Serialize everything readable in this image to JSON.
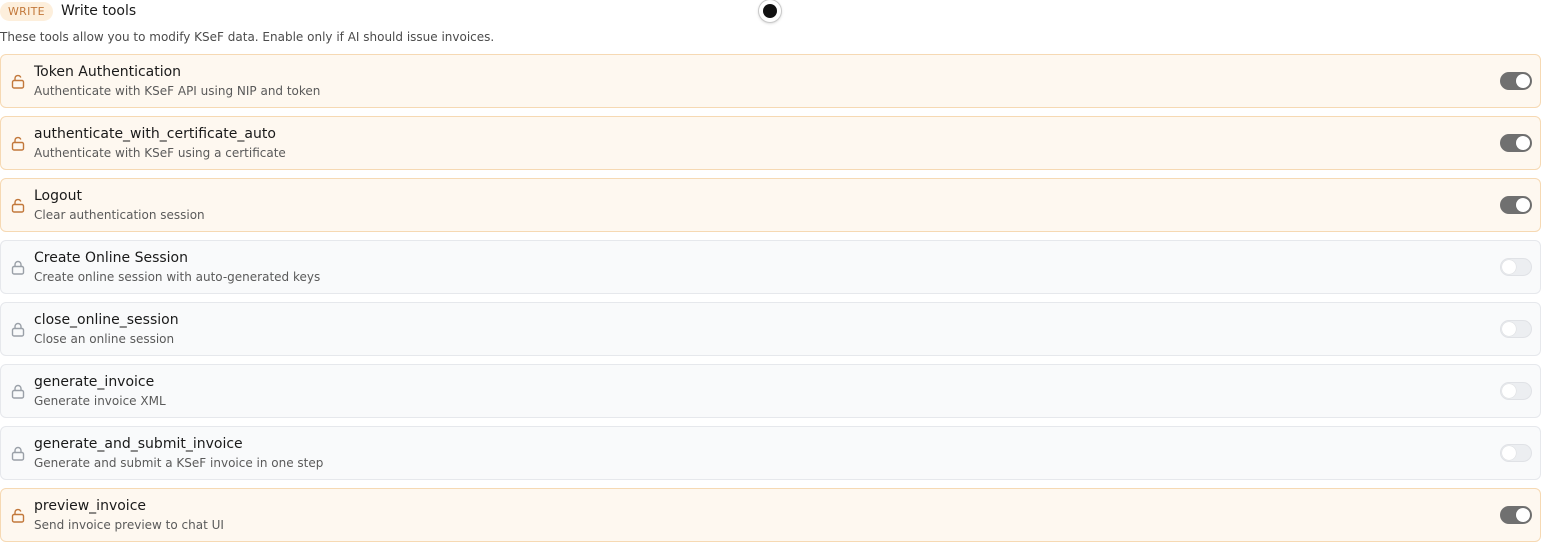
{
  "header": {
    "badge": "WRITE",
    "title": "Write tools",
    "description": "These tools allow you to modify KSeF data. Enable only if AI should issue invoices."
  },
  "colors": {
    "enabled_border": "#f6d9b3",
    "enabled_bg": "#fef8f0",
    "enabled_lock": "#c2783b",
    "disabled_lock": "#9aa0a8",
    "toggle_on": "#707070",
    "badge_text": "#c2783b",
    "badge_bg": "#fdefdc"
  },
  "tools": [
    {
      "title": "Token Authentication",
      "subtitle": "Authenticate with KSeF API using NIP and token",
      "enabled": true,
      "icon": "unlock-icon"
    },
    {
      "title": "authenticate_with_certificate_auto",
      "subtitle": "Authenticate with KSeF using a certificate",
      "enabled": true,
      "icon": "unlock-icon"
    },
    {
      "title": "Logout",
      "subtitle": "Clear authentication session",
      "enabled": true,
      "icon": "unlock-icon"
    },
    {
      "title": "Create Online Session",
      "subtitle": "Create online session with auto-generated keys",
      "enabled": false,
      "icon": "lock-icon"
    },
    {
      "title": "close_online_session",
      "subtitle": "Close an online session",
      "enabled": false,
      "icon": "lock-icon"
    },
    {
      "title": "generate_invoice",
      "subtitle": "Generate invoice XML",
      "enabled": false,
      "icon": "lock-icon"
    },
    {
      "title": "generate_and_submit_invoice",
      "subtitle": "Generate and submit a KSeF invoice in one step",
      "enabled": false,
      "icon": "lock-icon"
    },
    {
      "title": "preview_invoice",
      "subtitle": "Send invoice preview to chat UI",
      "enabled": true,
      "icon": "unlock-icon"
    }
  ]
}
